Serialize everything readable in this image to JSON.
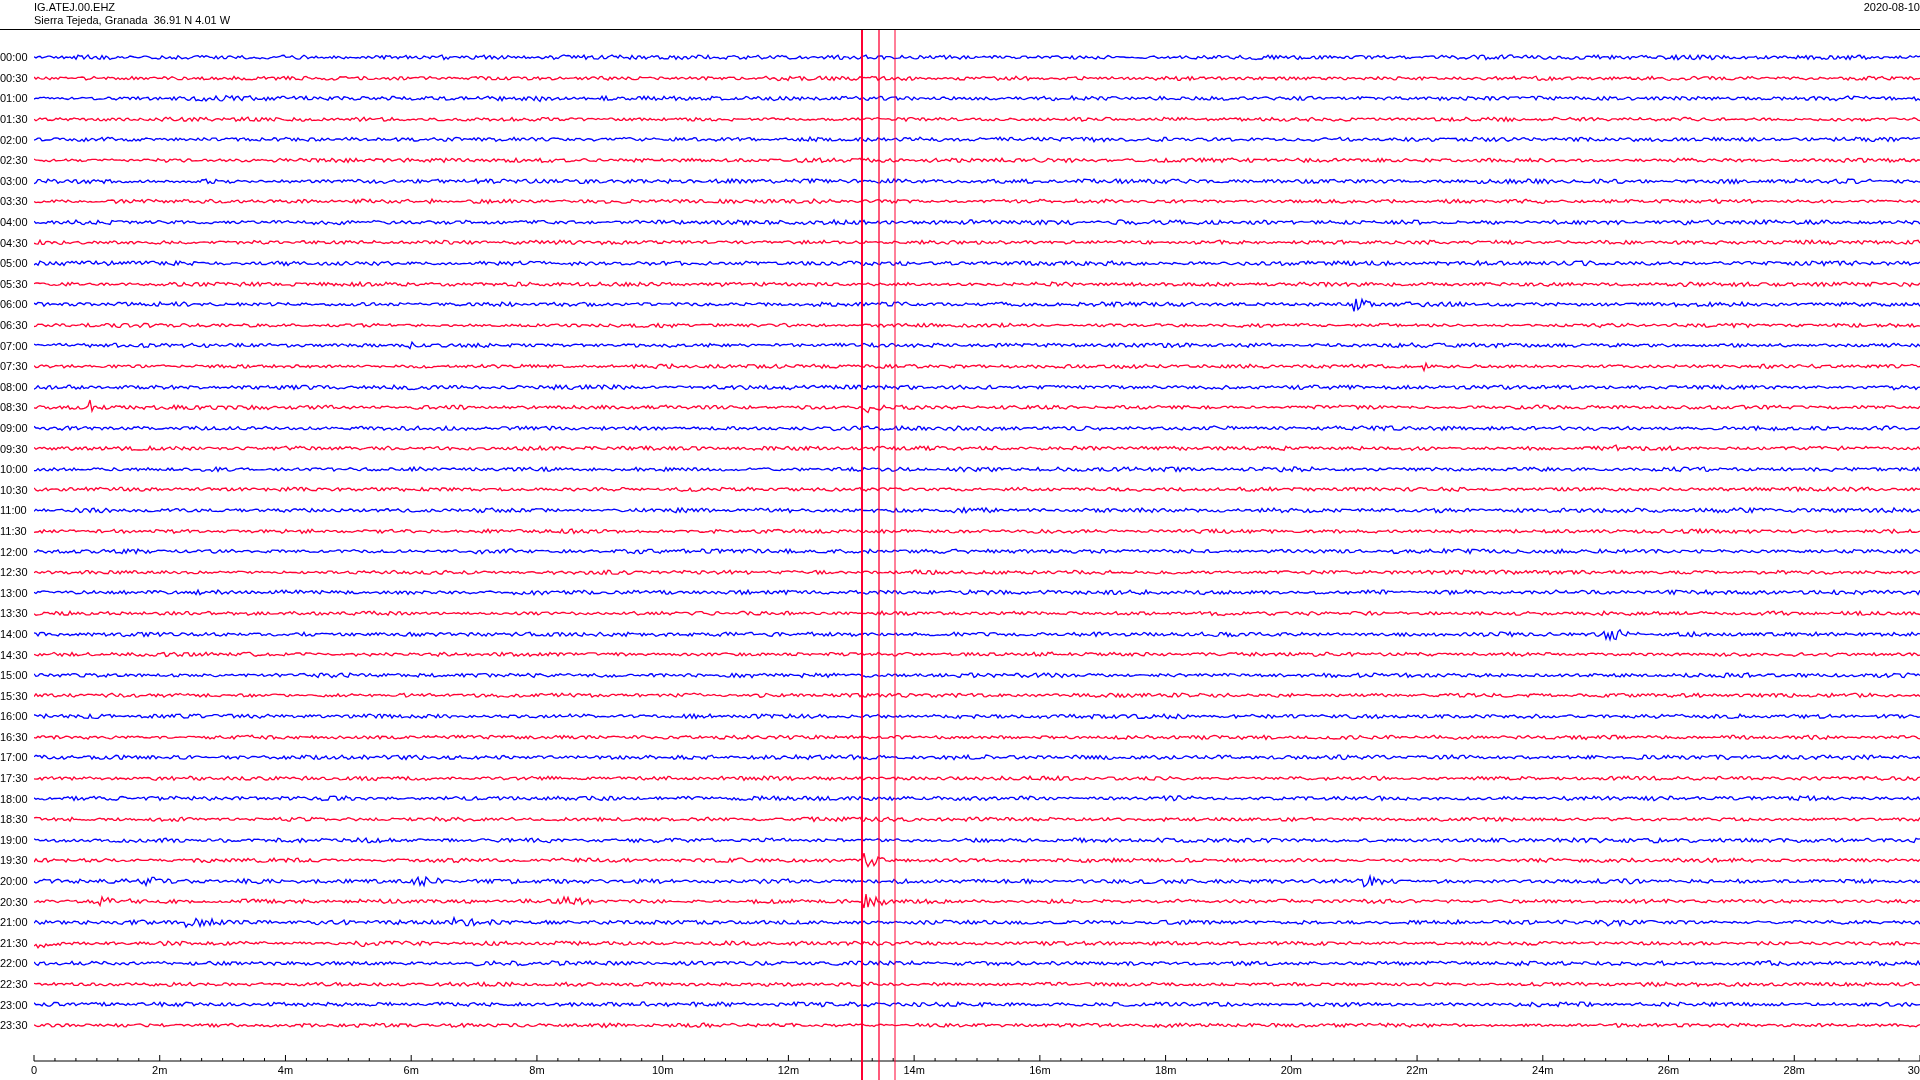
{
  "header": {
    "station": "IG.ATEJ.00.EHZ",
    "location": "Sierra Tejeda, Granada  36.91 N 4.01 W",
    "date": "2020-08-10"
  },
  "rows": [
    {
      "label": "00:00",
      "color": "#0000ff"
    },
    {
      "label": "00:30",
      "color": "#ff0033"
    },
    {
      "label": "01:00",
      "color": "#0000ff"
    },
    {
      "label": "01:30",
      "color": "#ff0033"
    },
    {
      "label": "02:00",
      "color": "#0000ff"
    },
    {
      "label": "02:30",
      "color": "#ff0033"
    },
    {
      "label": "03:00",
      "color": "#0000ff"
    },
    {
      "label": "03:30",
      "color": "#ff0033"
    },
    {
      "label": "04:00",
      "color": "#0000ff"
    },
    {
      "label": "04:30",
      "color": "#ff0033"
    },
    {
      "label": "05:00",
      "color": "#0000ff"
    },
    {
      "label": "05:30",
      "color": "#ff0033"
    },
    {
      "label": "06:00",
      "color": "#0000ff"
    },
    {
      "label": "06:30",
      "color": "#ff0033"
    },
    {
      "label": "07:00",
      "color": "#0000ff"
    },
    {
      "label": "07:30",
      "color": "#ff0033"
    },
    {
      "label": "08:00",
      "color": "#0000ff"
    },
    {
      "label": "08:30",
      "color": "#ff0033"
    },
    {
      "label": "09:00",
      "color": "#0000ff"
    },
    {
      "label": "09:30",
      "color": "#ff0033"
    },
    {
      "label": "10:00",
      "color": "#0000ff"
    },
    {
      "label": "10:30",
      "color": "#ff0033"
    },
    {
      "label": "11:00",
      "color": "#0000ff"
    },
    {
      "label": "11:30",
      "color": "#ff0033"
    },
    {
      "label": "12:00",
      "color": "#0000ff"
    },
    {
      "label": "12:30",
      "color": "#ff0033"
    },
    {
      "label": "13:00",
      "color": "#0000ff"
    },
    {
      "label": "13:30",
      "color": "#ff0033"
    },
    {
      "label": "14:00",
      "color": "#0000ff"
    },
    {
      "label": "14:30",
      "color": "#ff0033"
    },
    {
      "label": "15:00",
      "color": "#0000ff"
    },
    {
      "label": "15:30",
      "color": "#ff0033"
    },
    {
      "label": "16:00",
      "color": "#0000ff"
    },
    {
      "label": "16:30",
      "color": "#ff0033"
    },
    {
      "label": "17:00",
      "color": "#0000ff"
    },
    {
      "label": "17:30",
      "color": "#ff0033"
    },
    {
      "label": "18:00",
      "color": "#0000ff"
    },
    {
      "label": "18:30",
      "color": "#ff0033"
    },
    {
      "label": "19:00",
      "color": "#0000ff"
    },
    {
      "label": "19:30",
      "color": "#ff0033"
    },
    {
      "label": "20:00",
      "color": "#0000ff"
    },
    {
      "label": "20:30",
      "color": "#ff0033"
    },
    {
      "label": "21:00",
      "color": "#0000ff"
    },
    {
      "label": "21:30",
      "color": "#ff0033"
    },
    {
      "label": "22:00",
      "color": "#0000ff"
    },
    {
      "label": "22:30",
      "color": "#ff0033"
    },
    {
      "label": "23:00",
      "color": "#0000ff"
    },
    {
      "label": "23:30",
      "color": "#ff0033"
    }
  ],
  "x_axis": {
    "labels": [
      "0",
      "2m",
      "4m",
      "6m",
      "8m",
      "10m",
      "12m",
      "14m",
      "16m",
      "18m",
      "20m",
      "22m",
      "24m",
      "26m",
      "28m",
      "30"
    ]
  }
}
